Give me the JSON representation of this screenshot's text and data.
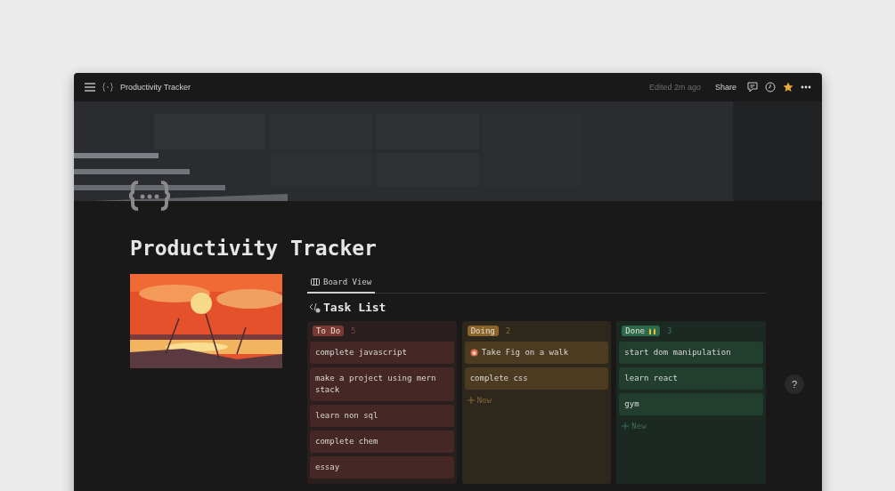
{
  "topbar": {
    "breadcrumb": "Productivity Tracker",
    "edited": "Edited 2m ago",
    "share": "Share"
  },
  "title": "Productivity Tracker",
  "help": "?",
  "board": {
    "tabs": [
      {
        "label": "Board View",
        "selected": true
      }
    ],
    "heading": "Task List",
    "columns": [
      {
        "name": "To Do",
        "count": "5",
        "color": "#7a3a33",
        "cards": [
          {
            "text": "complete javascript"
          },
          {
            "text": "make a project using mern stack"
          },
          {
            "text": "learn non sql"
          },
          {
            "text": "complete chem"
          },
          {
            "text": "essay"
          }
        ]
      },
      {
        "name": "Doing",
        "count": "2",
        "color": "#8a6428",
        "cards": [
          {
            "text": "Take Fig on a walk",
            "kind": "emoji"
          },
          {
            "text": "complete css"
          }
        ],
        "new_label": "New"
      },
      {
        "name": "Done",
        "count": "3",
        "color": "#2c6b4a",
        "emoji": true,
        "cards": [
          {
            "text": "start dom manipulation"
          },
          {
            "text": "learn react"
          },
          {
            "text": "gym"
          }
        ],
        "new_label": "New"
      }
    ]
  }
}
